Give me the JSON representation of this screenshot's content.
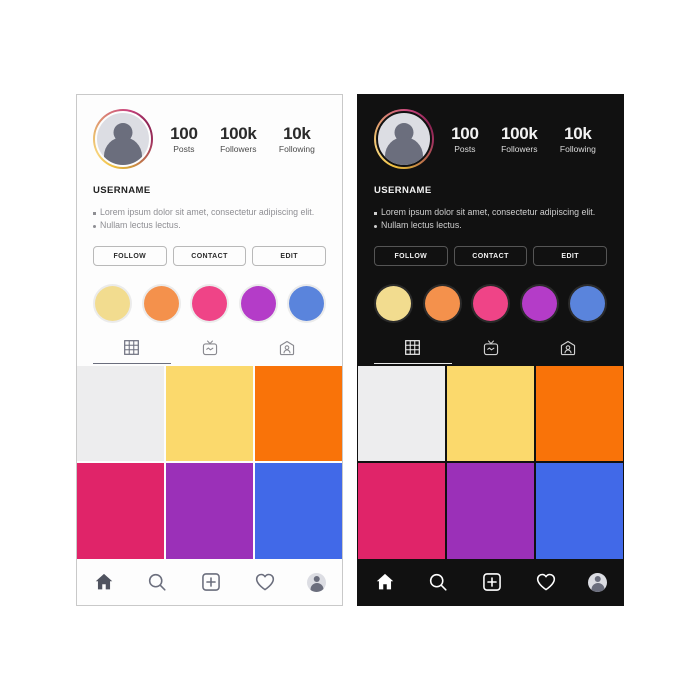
{
  "panels": [
    {
      "theme": "light",
      "name": "profile-panel-light"
    },
    {
      "theme": "dark",
      "name": "profile-panel-dark"
    }
  ],
  "profile": {
    "username": "USERNAME",
    "avatar_icon": "user-avatar-icon",
    "stats": [
      {
        "value": "100",
        "label": "Posts"
      },
      {
        "value": "100k",
        "label": "Followers"
      },
      {
        "value": "10k",
        "label": "Following"
      }
    ],
    "bio": [
      "Lorem ipsum dolor sit amet,",
      "consectetur adipiscing elit.",
      "Nullam lectus lectus."
    ],
    "bio_lines": [
      {
        "text": "Lorem ipsum dolor sit amet, consectetur adipiscing elit.",
        "bullet": "square"
      },
      {
        "text": "Nullam lectus lectus.",
        "bullet": "round"
      }
    ]
  },
  "actions": [
    {
      "label": "FOLLOW",
      "name": "follow-button"
    },
    {
      "label": "CONTACT",
      "name": "contact-button"
    },
    {
      "label": "EDIT",
      "name": "edit-button"
    }
  ],
  "highlights": [
    {
      "name": "story-highlight-1",
      "color": "#F2DC8F"
    },
    {
      "name": "story-highlight-2",
      "color": "#F4914C"
    },
    {
      "name": "story-highlight-3",
      "color": "#EF4487"
    },
    {
      "name": "story-highlight-4",
      "color": "#B43CC8"
    },
    {
      "name": "story-highlight-5",
      "color": "#5A84DC"
    }
  ],
  "tabs": [
    {
      "name": "tab-grid",
      "icon": "grid-icon",
      "active": true
    },
    {
      "name": "tab-igtv",
      "icon": "tv-icon",
      "active": false
    },
    {
      "name": "tab-tagged",
      "icon": "tagged-icon",
      "active": false
    }
  ],
  "grid_tiles": [
    {
      "name": "grid-tile-1",
      "color": "#EDEDEE"
    },
    {
      "name": "grid-tile-2",
      "color": "#FBD96C"
    },
    {
      "name": "grid-tile-3",
      "color": "#F97309"
    },
    {
      "name": "grid-tile-4",
      "color": "#E02469"
    },
    {
      "name": "grid-tile-5",
      "color": "#9B30B8"
    },
    {
      "name": "grid-tile-6",
      "color": "#4169E8"
    }
  ],
  "navbar": [
    {
      "name": "nav-home-button",
      "icon": "home-icon"
    },
    {
      "name": "nav-search-button",
      "icon": "search-icon"
    },
    {
      "name": "nav-add-button",
      "icon": "plus-square-icon"
    },
    {
      "name": "nav-activity-button",
      "icon": "heart-icon"
    },
    {
      "name": "nav-profile-button",
      "icon": "profile-avatar-icon"
    }
  ],
  "colors": {
    "light_bg": "#FDFDFD",
    "dark_bg": "#111111",
    "accent_underline": "#6B6E7D"
  }
}
